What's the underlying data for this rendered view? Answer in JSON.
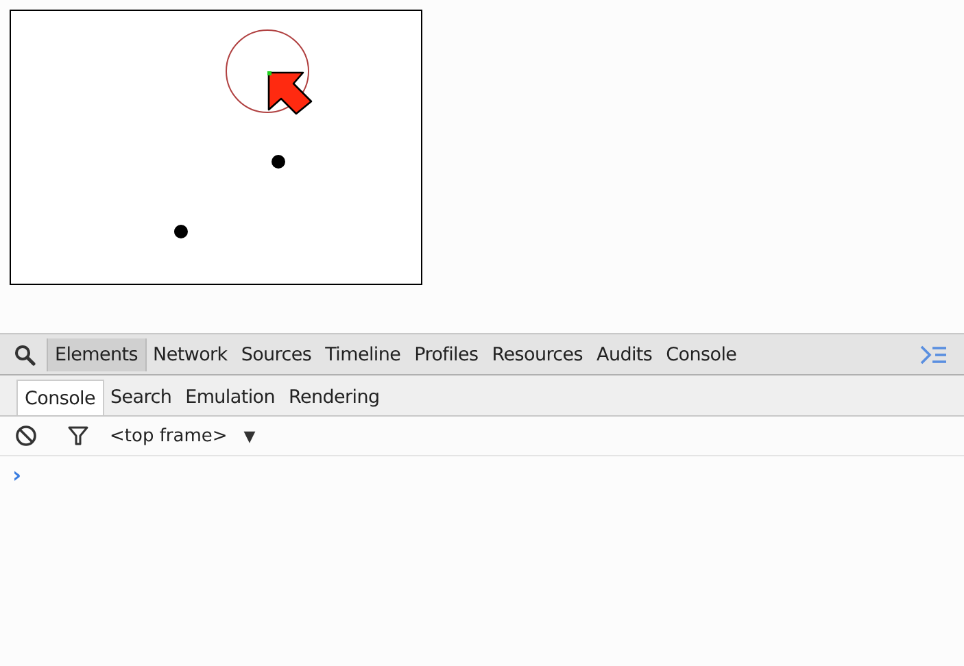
{
  "tabs": [
    {
      "label": "Elements",
      "selected": true
    },
    {
      "label": "Network",
      "selected": false
    },
    {
      "label": "Sources",
      "selected": false
    },
    {
      "label": "Timeline",
      "selected": false
    },
    {
      "label": "Profiles",
      "selected": false
    },
    {
      "label": "Resources",
      "selected": false
    },
    {
      "label": "Audits",
      "selected": false
    },
    {
      "label": "Console",
      "selected": false
    }
  ],
  "drawer_tabs": [
    {
      "label": "Console",
      "selected": true
    },
    {
      "label": "Search",
      "selected": false
    },
    {
      "label": "Emulation",
      "selected": false
    },
    {
      "label": "Rendering",
      "selected": false
    }
  ],
  "console_toolbar": {
    "frame": "<top frame>",
    "dropdown_arrow": "▼"
  },
  "console": {
    "prompt": "›"
  }
}
